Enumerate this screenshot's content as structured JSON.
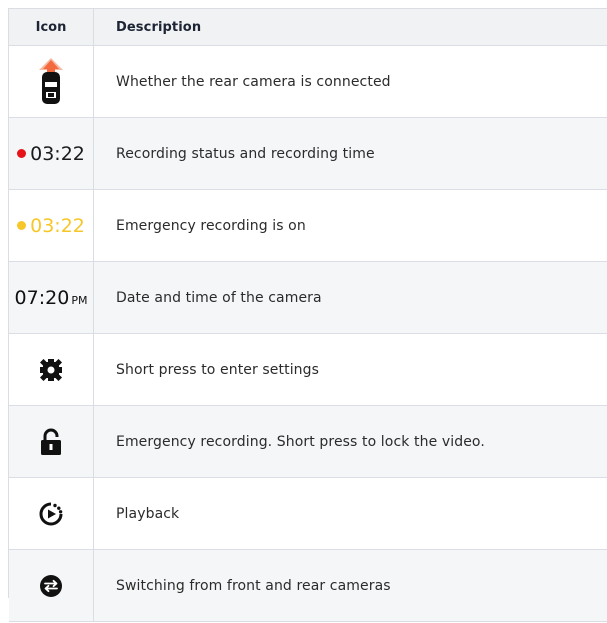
{
  "table": {
    "headers": {
      "icon": "Icon",
      "description": "Description"
    },
    "rows": [
      {
        "icon": "rear-camera-icon",
        "description": "Whether the rear camera is connected"
      },
      {
        "icon": "recording-status-indicator",
        "time": "03:22",
        "dot_color": "#e8131a",
        "text_color": "#1b1b1b",
        "description": "Recording status and recording time"
      },
      {
        "icon": "emergency-recording-indicator",
        "time": "03:22",
        "dot_color": "#f7c72a",
        "text_color": "#f7c72a",
        "description": "Emergency recording is on"
      },
      {
        "icon": "clock-display",
        "time": "07:20",
        "suffix": "PM",
        "description": "Date and time of the camera"
      },
      {
        "icon": "settings-gear-icon",
        "description": "Short press to enter settings"
      },
      {
        "icon": "lock-icon",
        "description": "Emergency recording. Short press to lock the video."
      },
      {
        "icon": "playback-icon",
        "description": "Playback"
      },
      {
        "icon": "switch-camera-icon",
        "description": "Switching from front and rear cameras"
      }
    ]
  },
  "colors": {
    "border": "#dadde3",
    "zebra": "#f5f6f8",
    "header_bg": "#f1f2f4",
    "icon": "#111111",
    "rear_cam_accent": "#f26a3d"
  }
}
